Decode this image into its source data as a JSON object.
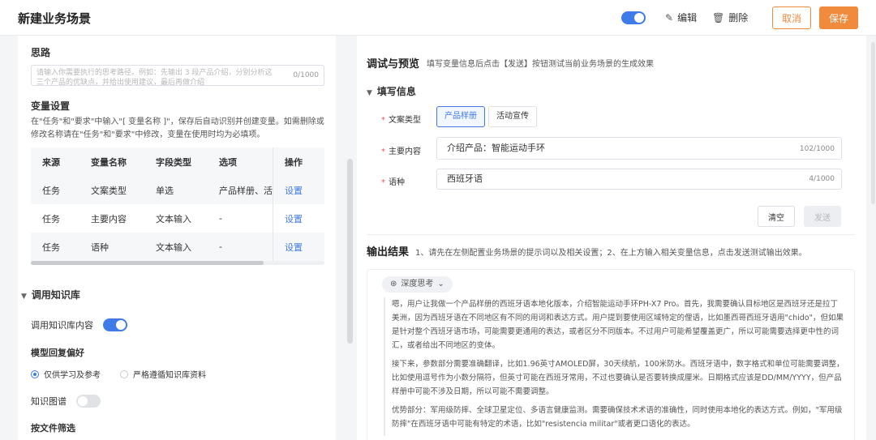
{
  "header": {
    "title": "新建业务场景",
    "edit_label": "编辑",
    "delete_label": "删除",
    "cancel_label": "取消",
    "save_label": "保存",
    "toggle_on": true,
    "edit_icon": "pencil-icon",
    "delete_icon": "trash-icon"
  },
  "left": {
    "idea": {
      "title": "思路",
      "placeholder_line1": "请输入你需要执行的思考路径。例如：先输出 3 段产品介绍，分别分析这",
      "placeholder_line2": "三个产品的优缺点，并给出使用建议，最后再做介绍",
      "count": "0/1000"
    },
    "variables": {
      "title": "变量设置",
      "description": "在\"任务\"和\"要求\"中输入\"[ 变量名称 ]\"，保存后自动识别并创建变量。如需删除或修改名称请在\"任务\"和\"要求\"中修改，变量在使用时均为必填项。",
      "columns": [
        "来源",
        "变量名称",
        "字段类型",
        "选项",
        "操作"
      ],
      "rows": [
        {
          "source": "任务",
          "name": "文案类型",
          "type": "单选",
          "options": "产品样册、活",
          "action": "设置"
        },
        {
          "source": "任务",
          "name": "主要内容",
          "type": "文本输入",
          "options": "-",
          "action": "设置"
        },
        {
          "source": "任务",
          "name": "语种",
          "type": "文本输入",
          "options": "-",
          "action": "设置"
        }
      ]
    },
    "knowledge": {
      "title": "调用知识库",
      "use_label": "调用知识库内容",
      "use_on": true,
      "preference_title": "模型回复偏好",
      "option_reference": "仅供学习及参考",
      "option_strict": "严格遵循知识库资料",
      "selected": "仅供学习及参考",
      "graph_label": "知识图谱",
      "graph_on": false,
      "filter_title": "按文件筛选"
    }
  },
  "right": {
    "title": "调试与预览",
    "subtitle": "填写变量信息后点击【发送】按钮测试当前业务场景的生成效果",
    "fill_title": "填写信息",
    "copy_type_label": "文案类型",
    "copy_type_options": [
      "产品样册",
      "活动宣传"
    ],
    "copy_type_selected": "产品样册",
    "main_content_label": "主要内容",
    "main_content_value": "介绍产品：智能运动手环",
    "main_content_count": "102/1000",
    "language_label": "语种",
    "language_value": "西班牙语",
    "language_count": "4/1000",
    "clear_label": "清空",
    "send_label": "发送",
    "output_title": "输出结果",
    "output_hint": "1、请先在左侧配置业务场景的提示词以及相关设置；2、在上方输入相关变量信息，点击发送测试输出效果。",
    "deep_think_label": "深度思考",
    "deep_think_icon": "brain-icon",
    "paragraphs": [
      "嗯，用户让我做一个产品样册的西班牙语本地化版本，介绍智能运动手环PH-X7 Pro。首先，我需要确认目标地区是西班牙还是拉丁美洲，因为西班牙语在不同地区有不同的用词和表达方式。用户提到要使用区域特定的俚语，比如墨西哥西班牙语用\"chido\"，但如果是针对整个西班牙语市场，可能需要更通用的表达，或者区分不同版本。不过用户可能希望覆盖更广，所以可能需要选择更中性的词汇，或者给出不同地区的变体。",
      "接下来，参数部分需要准确翻译，比如1.96英寸AMOLED屏，30天续航，100米防水。西班牙语中，数字格式和单位可能需要调整，比如使用逗号作为小数分隔符，但英寸可能在西班牙常用，不过也要确认是否要转换成厘米。日期格式应该是DD/MM/YYYY，但产品样册中可能不涉及日期，所以可能不需要调整。",
      "优势部分：军用级防摔、全球卫星定位、多语言健康监测。需要确保技术术语的准确性，同时使用本地化的表达方式。例如，\"军用级防摔\"在西班牙语中可能有特定的术语，比如\"resistencia militar\"或者更口语化的表达。"
    ]
  }
}
